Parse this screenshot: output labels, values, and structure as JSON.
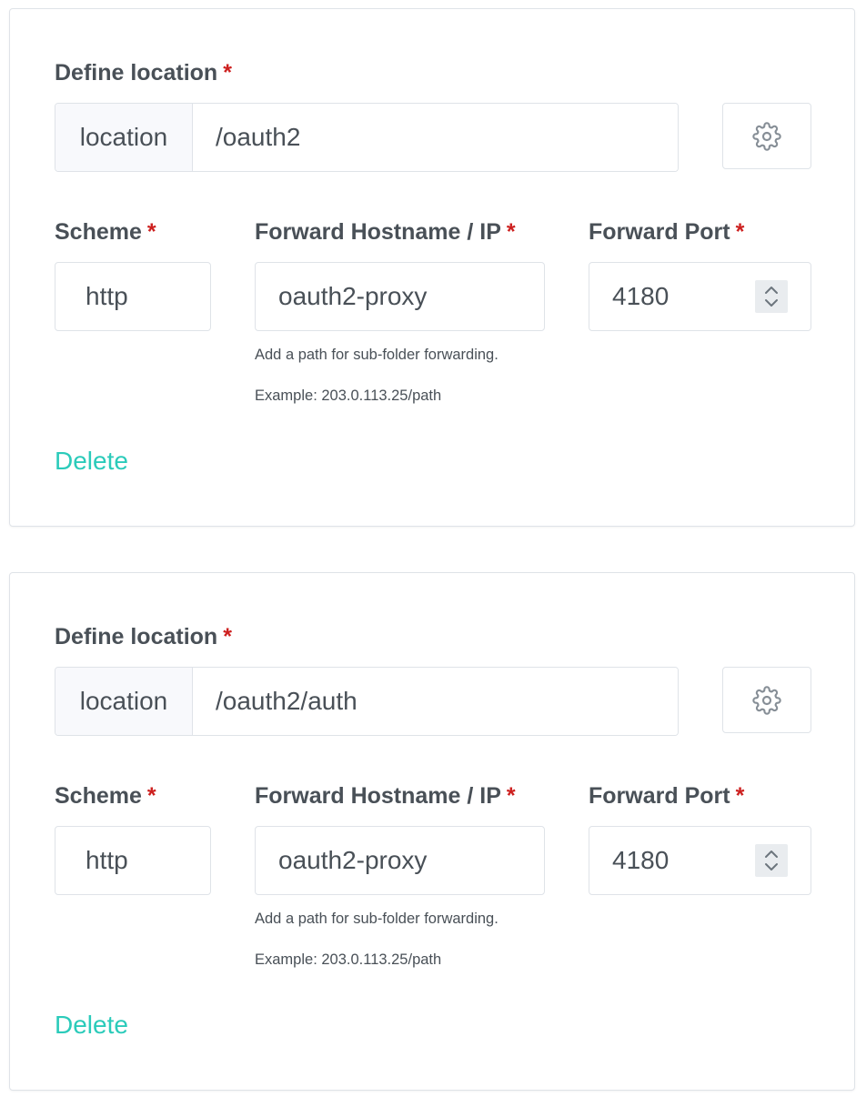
{
  "locations": [
    {
      "define_label": "Define location",
      "required_mark": "*",
      "prefix": "location",
      "path": "/oauth2",
      "scheme_label": "Scheme",
      "scheme_value": "http",
      "host_label": "Forward Hostname / IP",
      "host_value": "oauth2-proxy",
      "port_label": "Forward Port",
      "port_value": "4180",
      "help_line1": "Add a path for sub-folder forwarding.",
      "help_line2": "Example: 203.0.113.25/path",
      "delete_label": "Delete"
    },
    {
      "define_label": "Define location",
      "required_mark": "*",
      "prefix": "location",
      "path": "/oauth2/auth",
      "scheme_label": "Scheme",
      "scheme_value": "http",
      "host_label": "Forward Hostname / IP",
      "host_value": "oauth2-proxy",
      "port_label": "Forward Port",
      "port_value": "4180",
      "help_line1": "Add a path for sub-folder forwarding.",
      "help_line2": "Example: 203.0.113.25/path",
      "delete_label": "Delete"
    }
  ],
  "icons": {
    "settings": "gear-icon",
    "stepper": "chevron-up-down-icon"
  },
  "colors": {
    "required": "#cd201f",
    "link": "#2bcbba",
    "text": "#495057",
    "border": "#dfe3e8"
  }
}
